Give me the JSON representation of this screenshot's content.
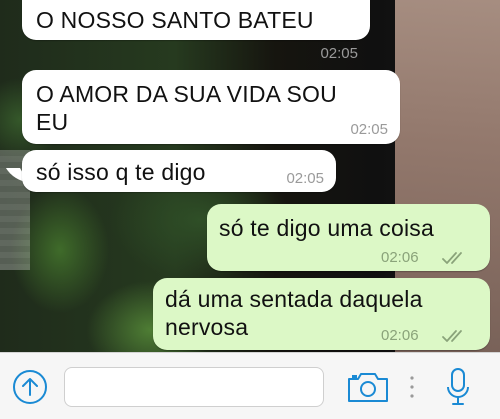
{
  "messages": [
    {
      "direction": "incoming",
      "text": "O NOSSO SANTO BATEU",
      "time": "02:05"
    },
    {
      "direction": "incoming",
      "text": "O AMOR DA SUA VIDA SOU\nEU",
      "time": "02:05"
    },
    {
      "direction": "incoming",
      "text": "só isso q te digo",
      "time": "02:05"
    },
    {
      "direction": "outgoing",
      "text": "só te digo uma coisa",
      "time": "02:06",
      "status": "read"
    },
    {
      "direction": "outgoing",
      "text": "dá uma sentada daquela\nnervosa",
      "time": "02:06",
      "status": "read"
    }
  ],
  "input_bar": {
    "message_placeholder": "",
    "icons": [
      "plus-circle-icon",
      "camera-icon",
      "more-dots-icon",
      "microphone-icon"
    ]
  },
  "colors": {
    "incoming_bubble": "#ffffff",
    "outgoing_bubble": "#dcf8c6",
    "accent": "#1a8ad4",
    "timestamp": "#9a9a9a",
    "read_check": "#8aa37a"
  }
}
